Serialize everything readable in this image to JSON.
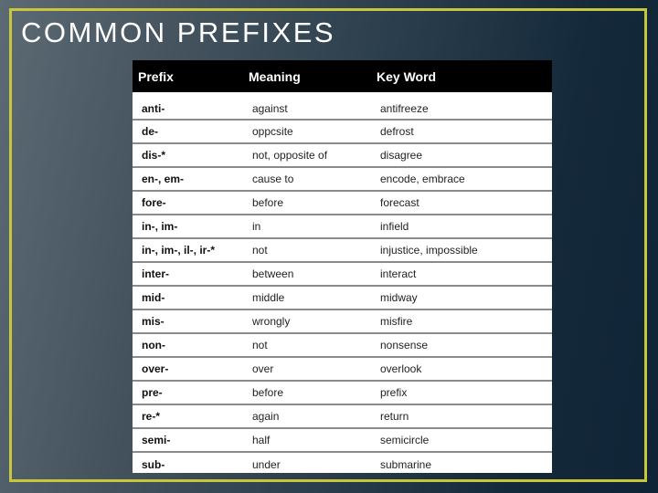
{
  "slide": {
    "title": "COMMON PREFIXES",
    "colors": {
      "frame_border": "#c8c63a",
      "header_bg": "#000000",
      "header_text": "#ffffff",
      "row_divider": "#8a8a8a"
    }
  },
  "table": {
    "headers": [
      "Prefix",
      "Meaning",
      "Key Word"
    ],
    "rows": [
      {
        "prefix": "anti-",
        "meaning": "against",
        "key_word": "antifreeze"
      },
      {
        "prefix": "de-",
        "meaning": "oppcsite",
        "key_word": "defrost"
      },
      {
        "prefix": "dis-*",
        "meaning": "not, opposite of",
        "key_word": "disagree"
      },
      {
        "prefix": "en-, em-",
        "meaning": "cause to",
        "key_word": "encode, embrace"
      },
      {
        "prefix": "fore-",
        "meaning": "before",
        "key_word": "forecast"
      },
      {
        "prefix": "in-, im-",
        "meaning": "in",
        "key_word": "infield"
      },
      {
        "prefix": "in-, im-, il-, ir-*",
        "meaning": "not",
        "key_word": "injustice, impossible"
      },
      {
        "prefix": "inter-",
        "meaning": "between",
        "key_word": "interact"
      },
      {
        "prefix": "mid-",
        "meaning": "middle",
        "key_word": "midway"
      },
      {
        "prefix": "mis-",
        "meaning": "wrongly",
        "key_word": "misfire"
      },
      {
        "prefix": "non-",
        "meaning": "not",
        "key_word": "nonsense"
      },
      {
        "prefix": "over-",
        "meaning": "over",
        "key_word": "overlook"
      },
      {
        "prefix": "pre-",
        "meaning": "before",
        "key_word": "prefix"
      },
      {
        "prefix": "re-*",
        "meaning": "again",
        "key_word": "return"
      },
      {
        "prefix": "semi-",
        "meaning": "half",
        "key_word": "semicircle"
      },
      {
        "prefix": "sub-",
        "meaning": "under",
        "key_word": "submarine"
      }
    ]
  }
}
